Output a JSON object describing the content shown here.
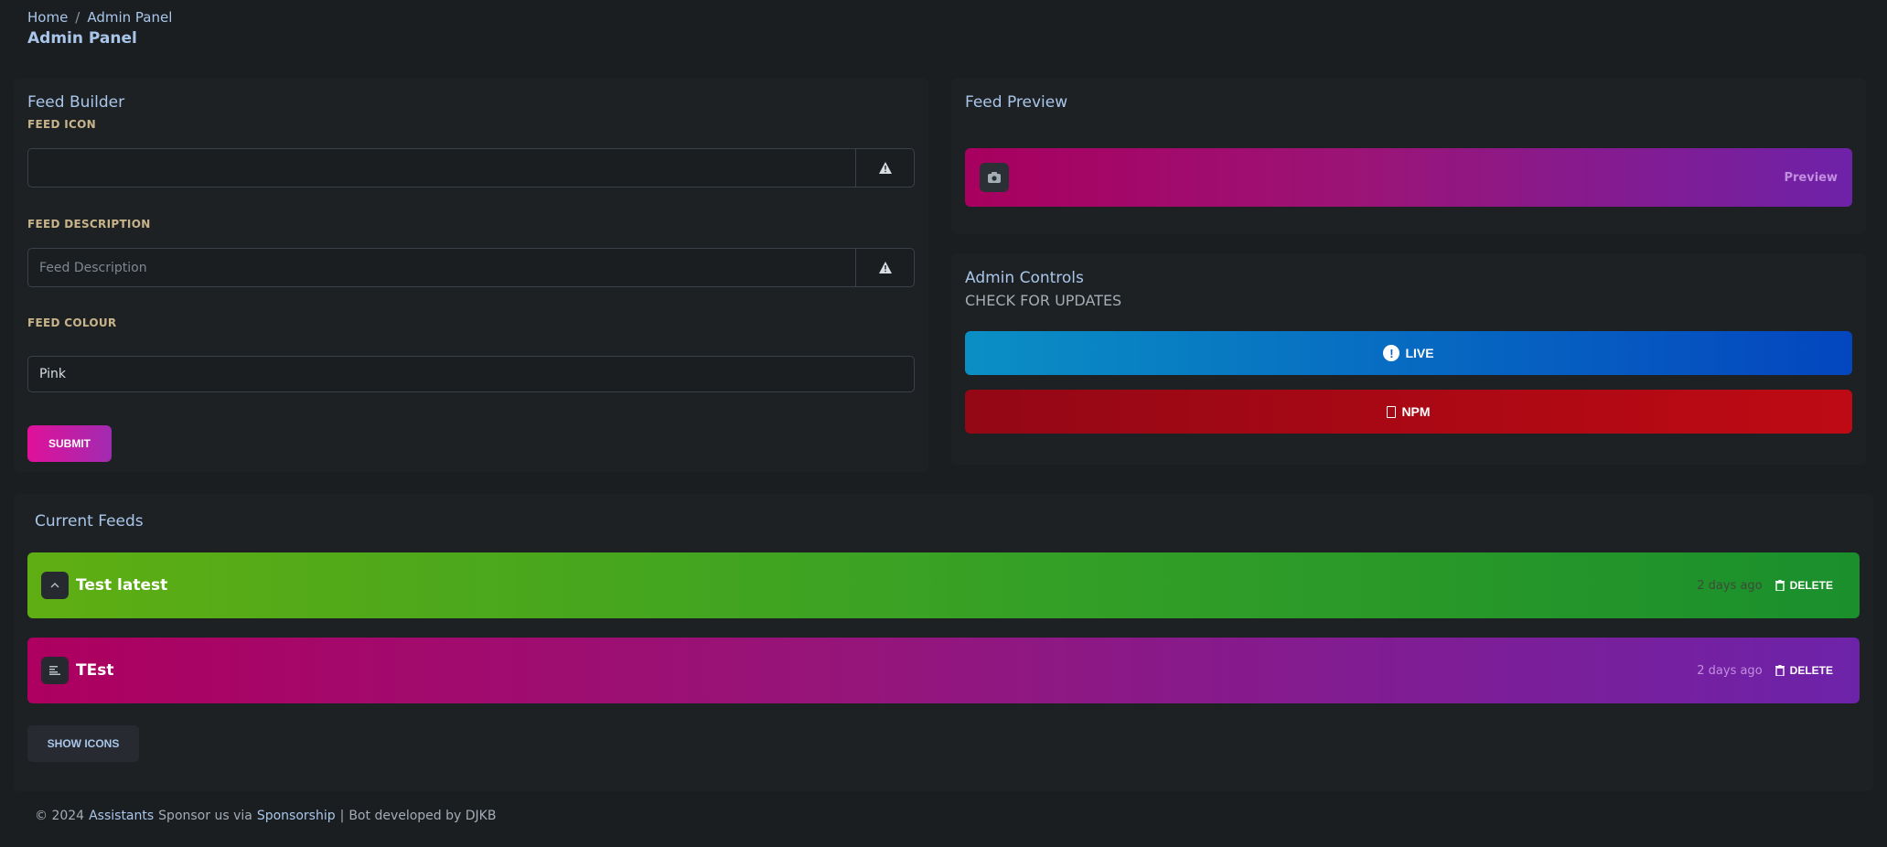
{
  "breadcrumb": {
    "home": "Home",
    "separator": "/",
    "current": "Admin Panel"
  },
  "page_title": "Admin Panel",
  "builder": {
    "title": "Feed Builder",
    "icon_label": "FEED ICON",
    "icon_value": "",
    "icon_addon": "warning-icon",
    "description_label": "FEED DESCRIPTION",
    "description_placeholder": "Feed Description",
    "description_addon": "warning-icon",
    "colour_label": "FEED COLOUR",
    "colour_value": "Pink",
    "submit_label": "SUBMIT"
  },
  "preview": {
    "title": "Feed Preview",
    "icon": "camera-icon",
    "label": "Preview"
  },
  "controls": {
    "title": "Admin Controls",
    "subtitle": "CHECK FOR UPDATES",
    "live_label": "LIVE",
    "live_icon": "exclamation-circle-icon",
    "npm_label": "NPM",
    "npm_icon": "npm-icon"
  },
  "feeds": {
    "title": "Current Feeds",
    "items": [
      {
        "name": "Test latest",
        "time": "2 days ago",
        "delete_label": "DELETE",
        "icon": "chevron-up-icon",
        "color": "#4ea81c"
      },
      {
        "name": "TEst",
        "time": "2 days ago",
        "delete_label": "DELETE",
        "icon": "align-left-icon",
        "color": "#96157a"
      }
    ],
    "show_icons_label": "SHOW ICONS"
  },
  "footer": {
    "copyright": "© 2024",
    "brand": "Assistants",
    "sponsor_text": "Sponsor us via",
    "sponsor_link": "Sponsorship",
    "separator": "|",
    "developer": "Bot developed by DJKB"
  },
  "colors": {
    "background": "#1b1e21",
    "card": "#1e2124",
    "accent": "#a9c6ea",
    "submit": "#e0119a"
  }
}
